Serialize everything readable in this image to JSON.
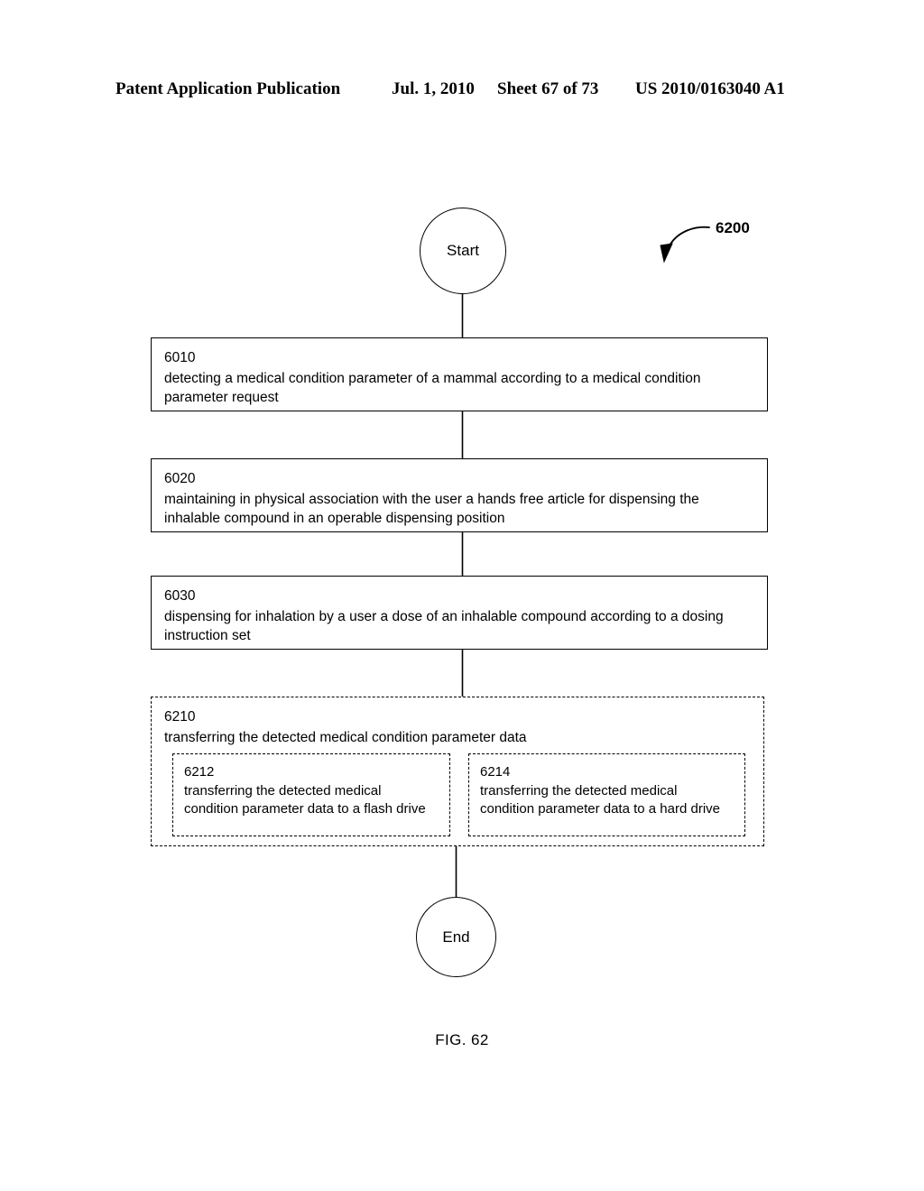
{
  "header": {
    "publication": "Patent Application Publication",
    "date": "Jul. 1, 2010",
    "sheet": "Sheet 67 of 73",
    "document_number": "US 2010/0163040 A1"
  },
  "figure": {
    "caption": "FIG. 62",
    "callout_label": "6200"
  },
  "flowchart": {
    "start_label": "Start",
    "end_label": "End",
    "steps": [
      {
        "number": "6010",
        "text": "detecting a medical condition parameter of a mammal according to a medical condition parameter request",
        "border": "solid"
      },
      {
        "number": "6020",
        "text": "maintaining in physical association with the user a hands free article for dispensing the inhalable compound in an operable dispensing position",
        "border": "solid"
      },
      {
        "number": "6030",
        "text": "dispensing for inhalation by a user a dose of an inhalable compound according to a dosing instruction set",
        "border": "solid"
      },
      {
        "number": "6210",
        "text": "transferring the detected medical condition parameter data",
        "border": "dashed",
        "substeps": [
          {
            "number": "6212",
            "text": "transferring the detected medical condition parameter data to a flash drive",
            "border": "dashed"
          },
          {
            "number": "6214",
            "text": "transferring the detected medical condition parameter data to a hard drive",
            "border": "dashed"
          }
        ]
      }
    ]
  },
  "colors": {
    "ink": "#000000",
    "page": "#ffffff"
  }
}
